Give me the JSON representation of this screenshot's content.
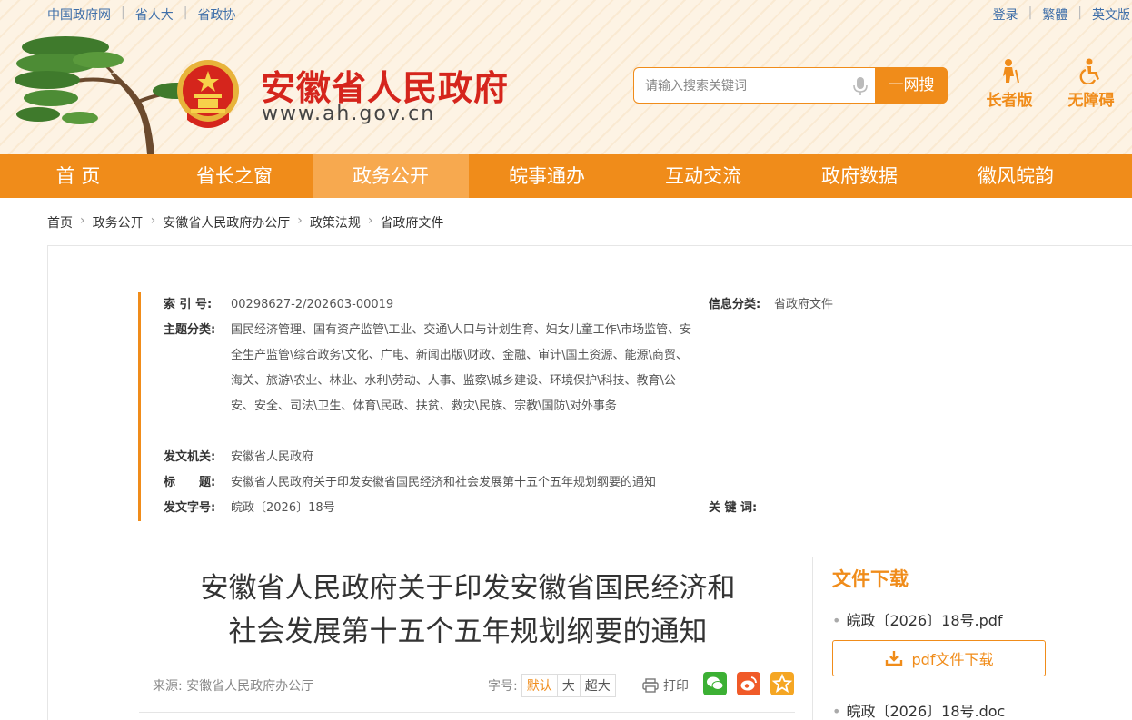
{
  "topbar": {
    "left_links": [
      "中国政府网",
      "省人大",
      "省政协"
    ],
    "right_links": [
      "登录",
      "繁體",
      "英文版"
    ]
  },
  "header": {
    "site_title": "安徽省人民政府",
    "site_url": "www.ah.gov.cn",
    "search_placeholder": "请输入搜索关键词",
    "search_button": "一网搜",
    "elder_label": "长者版",
    "accessible_label": "无障碍"
  },
  "nav": {
    "items": [
      "首 页",
      "省长之窗",
      "政务公开",
      "皖事通办",
      "互动交流",
      "政府数据",
      "徽风皖韵"
    ],
    "active_index": 2
  },
  "breadcrumb": [
    "首页",
    "政务公开",
    "安徽省人民政府办公厅",
    "政策法规",
    "省政府文件"
  ],
  "meta": {
    "index_label": "索 引 号:",
    "index_value": "00298627-2/202603-00019",
    "info_class_label": "信息分类:",
    "info_class_value": "省政府文件",
    "topic_label": "主题分类:",
    "topic_value": "国民经济管理、国有资产监管\\工业、交通\\人口与计划生育、妇女儿童工作\\市场监管、安全生产监管\\综合政务\\文化、广电、新闻出版\\财政、金融、审计\\国土资源、能源\\商贸、海关、旅游\\农业、林业、水利\\劳动、人事、监察\\城乡建设、环境保护\\科技、教育\\公安、安全、司法\\卫生、体育\\民政、扶贫、救灾\\民族、宗教\\国防\\对外事务",
    "issuer_label": "发文机关:",
    "issuer_value": "安徽省人民政府",
    "title_label": "标　　题:",
    "title_value": "安徽省人民政府关于印发安徽省国民经济和社会发展第十五个五年规划纲要的通知",
    "docno_label": "发文字号:",
    "docno_value": "皖政〔2026〕18号",
    "keywords_label": "关 键 词:",
    "keywords_value": ""
  },
  "article": {
    "title_line1": "安徽省人民政府关于印发安徽省国民经济和",
    "title_line2": "社会发展第十五个五年规划纲要的通知",
    "source": "来源:  安徽省人民政府办公厅",
    "fontsize_label": "字号:",
    "fontsize_options": [
      "默认",
      "大",
      "超大"
    ],
    "print_label": "打印"
  },
  "downloads": {
    "title": "文件下载",
    "file1": "皖政〔2026〕18号.pdf",
    "file1_button": "pdf文件下载",
    "file2": "皖政〔2026〕18号.doc"
  },
  "colors": {
    "accent": "#f08c1a",
    "title_red": "#d5251c",
    "link_blue": "#3f6fa9",
    "wechat_green": "#3cb034",
    "weibo_orange": "#f05a28",
    "favorite_orange": "#f5a623"
  }
}
